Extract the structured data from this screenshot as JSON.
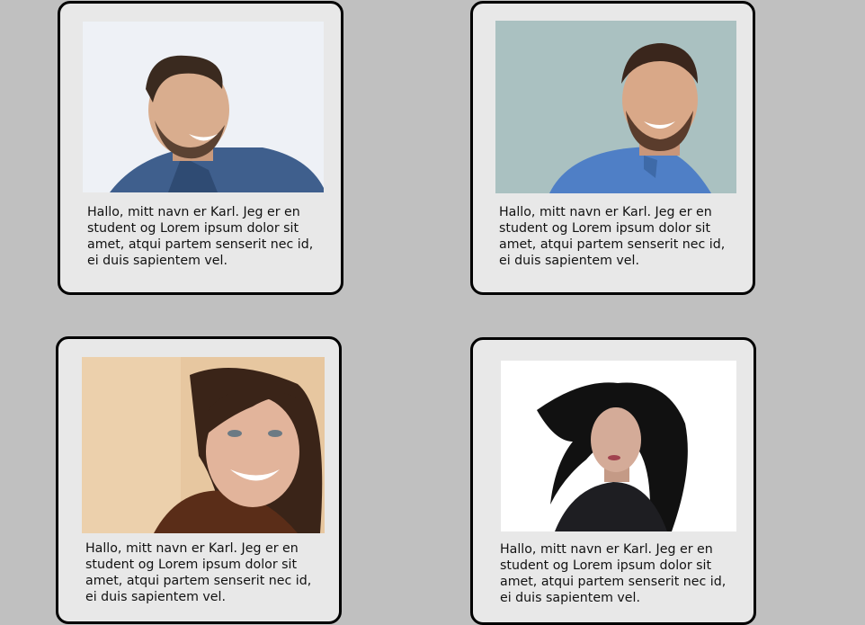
{
  "cards": [
    {
      "photo": "smiling-man-looking-right-photo",
      "bio": "Hallo, mitt navn er Karl. Jeg er en student og Lorem ipsum dolor sit amet, atqui partem senserit nec id, ei duis sapientem vel."
    },
    {
      "photo": "smiling-man-blue-shirt-photo",
      "bio": "Hallo, mitt navn er Karl. Jeg er en student og Lorem ipsum dolor sit amet, atqui partem senserit nec id, ei duis sapientem vel."
    },
    {
      "photo": "smiling-woman-brown-hair-photo",
      "bio": "Hallo, mitt navn er Karl. Jeg er en student og Lorem ipsum dolor sit amet, atqui partem senserit nec id, ei duis sapientem vel."
    },
    {
      "photo": "woman-black-hair-photo",
      "bio": "Hallo, mitt navn er Karl. Jeg er en student og Lorem ipsum dolor sit amet, atqui partem senserit nec id, ei duis sapientem vel."
    }
  ],
  "colors": {
    "page_background": "#c0c0c0",
    "card_background": "#e8e8e8",
    "card_border": "#000000",
    "text": "#111111"
  }
}
